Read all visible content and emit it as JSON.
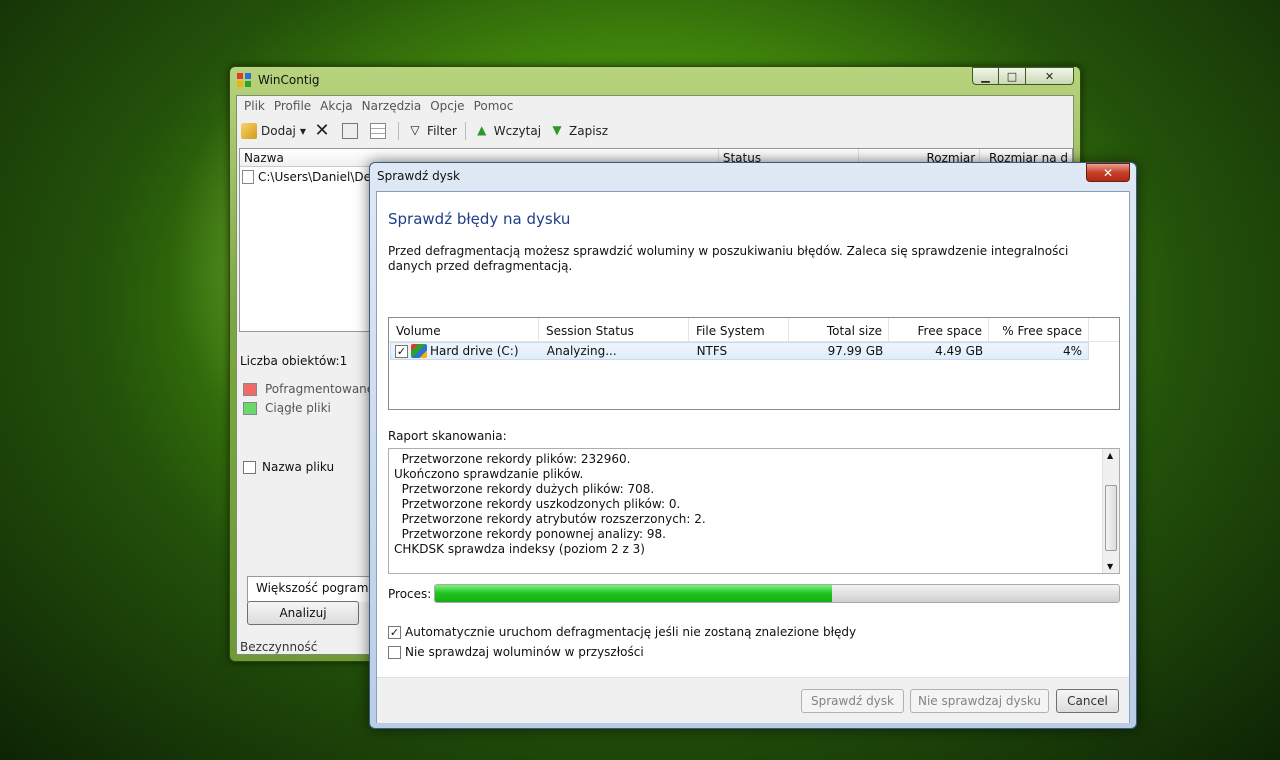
{
  "main_window": {
    "title": "WinContig",
    "menu": [
      "Plik",
      "Profile",
      "Akcja",
      "Narzędzia",
      "Opcje",
      "Pomoc"
    ],
    "toolbar": {
      "add": "Dodaj",
      "filter": "Filter",
      "load": "Wczytaj",
      "save": "Zapisz"
    },
    "list": {
      "columns": [
        "Nazwa",
        "Status",
        "Rozmiar",
        "Rozmiar na d"
      ],
      "rows": [
        {
          "name": "C:\\Users\\Daniel\\Desk"
        }
      ]
    },
    "object_count": "Liczba obiektów:1",
    "legend": [
      "Pofragmentowane p",
      "Ciągłe pliki"
    ],
    "filename_header": "Nazwa pliku",
    "tab": "Większość pograme",
    "analyze_button": "Analizuj",
    "status": "Bezczynność"
  },
  "dialog": {
    "title": "Sprawdź dysk",
    "heading": "Sprawdź błędy na dysku",
    "description": "Przed defragmentacją możesz sprawdzić woluminy w poszukiwaniu błędów. Zaleca się sprawdzenie integralności danych przed defragmentacją.",
    "volume_columns": [
      "Volume",
      "Session Status",
      "File System",
      "Total size",
      "Free space",
      "% Free space"
    ],
    "volumes": [
      {
        "volume": "Hard drive (C:)",
        "session_status": "Analyzing...",
        "file_system": "NTFS",
        "total_size": "97.99 GB",
        "free_space": "4.49 GB",
        "free_pct": "4%",
        "checked": true
      }
    ],
    "scan_label": "Raport skanowania:",
    "scan_lines": [
      "  Przetworzone rekordy plików: 232960.",
      "Ukończono sprawdzanie plików.",
      "  Przetworzone rekordy dużych plików: 708.",
      "  Przetworzone rekordy uszkodzonych plików: 0.",
      "  Przetworzone rekordy atrybutów rozszerzonych: 2.",
      "  Przetworzone rekordy ponownej analizy: 98.",
      "CHKDSK sprawdza indeksy (poziom 2 z 3)"
    ],
    "progress_label": "Proces:",
    "progress_fraction": 0.58,
    "options": [
      {
        "label": "Automatycznie uruchom defragmentację jeśli nie zostaną znalezione błędy",
        "checked": true
      },
      {
        "label": "Nie sprawdzaj woluminów w przyszłości",
        "checked": false
      }
    ],
    "buttons": {
      "check": "Sprawdź dysk",
      "skip": "Nie sprawdzaj dysku",
      "cancel": "Cancel"
    }
  }
}
